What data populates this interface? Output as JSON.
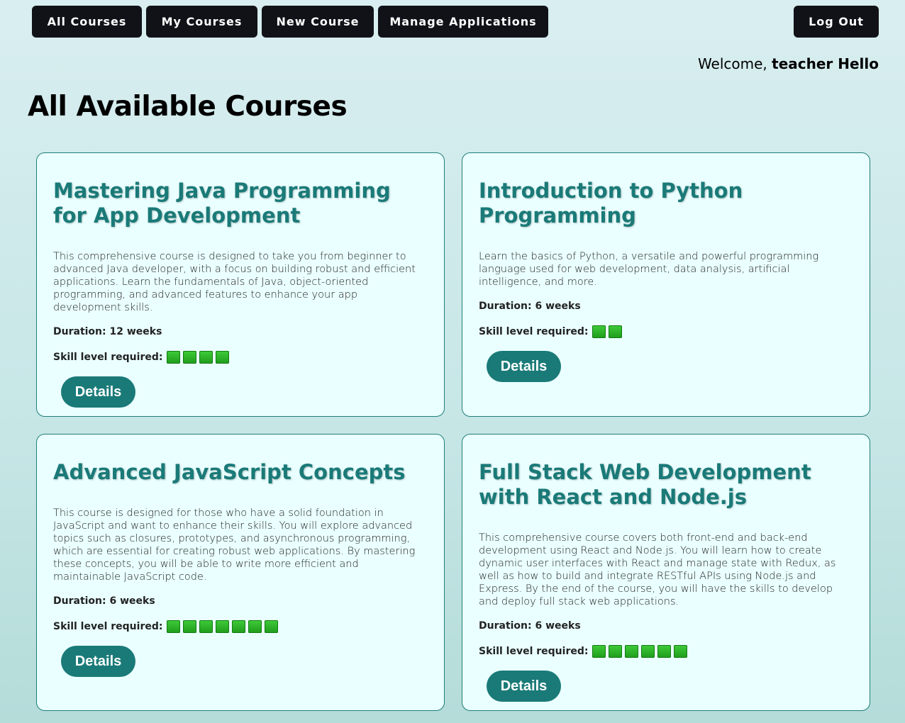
{
  "nav": {
    "all_courses": "All Courses",
    "my_courses": "My Courses",
    "new_course": "New Course",
    "manage_applications": "Manage Applications",
    "log_out": "Log Out"
  },
  "welcome": {
    "prefix": "Welcome, ",
    "user": "teacher Hello"
  },
  "page_title": "All Available Courses",
  "labels": {
    "skill": "Skill level required:",
    "details": "Details"
  },
  "courses": [
    {
      "title": "Mastering Java Programming for App Development",
      "description": "This comprehensive course is designed to take you from beginner to advanced Java developer, with a focus on building robust and efficient applications. Learn the fundamentals of Java, object-oriented programming, and advanced features to enhance your app development skills.",
      "duration": "Duration: 12 weeks",
      "skill_level": 4
    },
    {
      "title": "Introduction to Python Programming",
      "description": "Learn the basics of Python, a versatile and powerful programming language used for web development, data analysis, artificial intelligence, and more.",
      "duration": "Duration: 6 weeks",
      "skill_level": 2
    },
    {
      "title": "Advanced JavaScript Concepts",
      "description": "This course is designed for those who have a solid foundation in JavaScript and want to enhance their skills. You will explore advanced topics such as closures, prototypes, and asynchronous programming, which are essential for creating robust web applications. By mastering these concepts, you will be able to write more efficient and maintainable JavaScript code.",
      "duration": "Duration: 6 weeks",
      "skill_level": 7
    },
    {
      "title": "Full Stack Web Development with React and Node.js",
      "description": "This comprehensive course covers both front-end and back-end development using React and Node.js. You will learn how to create dynamic user interfaces with React and manage state with Redux, as well as how to build and integrate RESTful APIs using Node.js and Express. By the end of the course, you will have the skills to develop and deploy full stack web applications.",
      "duration": "Duration: 6 weeks",
      "skill_level": 6
    }
  ],
  "colors": {
    "accent": "#1a7a78",
    "nav_bg": "#111218",
    "card_bg": "#eaffff",
    "skill_square": "#2bb127"
  }
}
